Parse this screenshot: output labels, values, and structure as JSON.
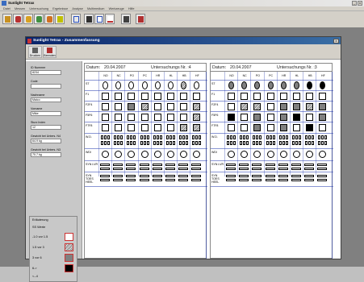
{
  "window": {
    "title": "Sunlight Tetrax"
  },
  "menu": [
    "Datei",
    "Messen",
    "Untersuchung",
    "Ergebnisse",
    "Analyse",
    "Multimedium",
    "Werkzeuge",
    "Hilfe"
  ],
  "toolbar_icons": [
    "patient-icon",
    "person-red-icon",
    "person-yellow-icon",
    "person-green-icon",
    "flag-icon",
    "footprint-icon",
    "monitor-icon",
    "chart-icon",
    "graph-icon",
    "screen-icon",
    "exit-icon"
  ],
  "dialog": {
    "title": "Sunlight Tetrax - Zusammenfassung",
    "print_label": "Drucken",
    "exit_label": "Beenden",
    "close_label": "x"
  },
  "patient": {
    "fields": [
      {
        "label": "ID Nummer",
        "value": "8234"
      },
      {
        "label": "Code",
        "value": ""
      },
      {
        "label": "Nachname",
        "value": "Maico"
      },
      {
        "label": "Vorname",
        "value": "Mike"
      },
      {
        "label": "Sturz Index",
        "value": "12"
      },
      {
        "label": "Gewicht bei Unters. N4",
        "value": "64.9 kg"
      },
      {
        "label": "Gewicht bei Unters. N3",
        "value": "70.7 kg"
      }
    ]
  },
  "legend": {
    "title": "Erläuterung",
    "subtitle": "SS Werte",
    "rows": [
      {
        "text": "-1.0  vor  1.5",
        "style": "empty"
      },
      {
        "text": "1.5  vor  3",
        "style": "hatched"
      },
      {
        "text": "3  vor  6",
        "style": "gray"
      },
      {
        "text": "6->",
        "style": "black"
      },
      {
        "text": "<--4",
        "style": "none"
      }
    ]
  },
  "columns": [
    "NO",
    "NC",
    "PO",
    "PC",
    "HR",
    "HL",
    "HB",
    "HF"
  ],
  "rows": [
    "ST",
    "F1",
    "F2F4",
    "F5F6",
    "F7F8",
    "W.D.",
    "WDI",
    "SYN LVR",
    "SYN TOES HEEL"
  ],
  "exams": [
    {
      "date_label": "Datum:",
      "date": "20.04.2007",
      "exam_label": "Untersuchungs Nr. :4",
      "ST": [
        "empty",
        "empty",
        "empty",
        "empty",
        "empty",
        "empty",
        "hatched",
        "empty"
      ],
      "F1": [
        "empty",
        "empty",
        "empty",
        "empty",
        "empty",
        "empty",
        "empty",
        "empty"
      ],
      "F2F4": [
        "empty",
        "empty",
        "gray",
        "hatched",
        "empty",
        "empty",
        "empty",
        "hatched"
      ],
      "F5F6": [
        "empty",
        "empty",
        "empty",
        "empty",
        "empty",
        "empty",
        "empty",
        "hatched"
      ],
      "F7F8": [
        "empty",
        "empty",
        "empty",
        "empty",
        "empty",
        "empty",
        "hatched",
        "hatched"
      ]
    },
    {
      "date_label": "Datum:",
      "date": "20.04.2007",
      "exam_label": "Untersuchungs Nr. :3",
      "ST": [
        "gray",
        "gray",
        "gray",
        "gray",
        "gray",
        "gray",
        "black",
        "black"
      ],
      "F1": [
        "empty",
        "empty",
        "empty",
        "empty",
        "empty",
        "empty",
        "empty",
        "empty"
      ],
      "F2F4": [
        "empty",
        "hatched",
        "hatched",
        "empty",
        "gray",
        "gray",
        "hatched",
        "gray"
      ],
      "F5F6": [
        "black",
        "empty",
        "gray",
        "empty",
        "gray",
        "black",
        "empty",
        "gray"
      ],
      "F7F8": [
        "empty",
        "empty",
        "gray",
        "empty",
        "gray",
        "empty",
        "black",
        "empty"
      ]
    }
  ],
  "colors": {
    "grid_line": "#2a3fb0",
    "title_bar": "#0a246a",
    "gray_fill": "#808080",
    "black_fill": "#000000",
    "legend_border": "#cc3333"
  }
}
